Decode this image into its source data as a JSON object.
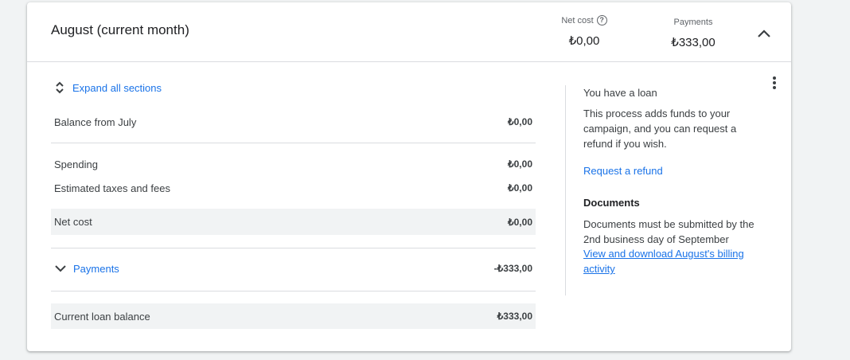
{
  "header": {
    "title": "August (current month)",
    "net_cost_label": "Net cost",
    "net_cost_value": "₺0,00",
    "payments_label": "Payments",
    "payments_value": "₺333,00"
  },
  "summary": {
    "expand_all": "Expand all sections",
    "balance_from": {
      "label": "Balance from July",
      "value": "₺0,00"
    },
    "spending": {
      "label": "Spending",
      "value": "₺0,00"
    },
    "taxes": {
      "label": "Estimated taxes and fees",
      "value": "₺0,00"
    },
    "net_cost": {
      "label": "Net cost",
      "value": "₺0,00"
    },
    "payments": {
      "label": "Payments",
      "value": "-₺333,00"
    },
    "loan_balance": {
      "label": "Current loan balance",
      "value": "₺333,00"
    }
  },
  "side": {
    "loan_title": "You have a loan",
    "loan_text": "This process adds funds to your campaign, and you can request a refund if you wish.",
    "refund_link": "Request a refund",
    "docs_title": "Documents",
    "docs_text": "Documents must be submitted by the 2nd business day of September",
    "docs_link": "View and download August's billing activity"
  },
  "colors": {
    "link": "#1a73e8",
    "shade": "#f1f3f4",
    "divider": "#dadce0"
  },
  "icons": [
    "help-icon",
    "chevron-up-icon",
    "unfold-more-icon",
    "chevron-down-icon",
    "more-vert-icon"
  ]
}
